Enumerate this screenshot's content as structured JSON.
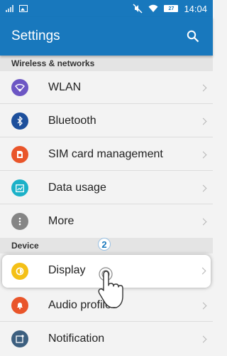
{
  "status_bar": {
    "time": "14:04",
    "battery": "27",
    "icons": [
      "signal-icon",
      "picture-icon",
      "mute-icon",
      "wifi-icon",
      "battery-icon"
    ]
  },
  "app_bar": {
    "title": "Settings",
    "search_icon": "search-icon"
  },
  "sections": {
    "wireless": "Wireless & networks",
    "device": "Device"
  },
  "items": [
    {
      "label": "WLAN",
      "icon": "wifi-icon",
      "color": "#6c56c4"
    },
    {
      "label": "Bluetooth",
      "icon": "bluetooth-icon",
      "color": "#1c4f9c"
    },
    {
      "label": "SIM card management",
      "icon": "sim-card-icon",
      "color": "#e9552a"
    },
    {
      "label": "Data usage",
      "icon": "data-usage-icon",
      "color": "#1bb1c8"
    },
    {
      "label": "More",
      "icon": "more-icon",
      "color": "#858585"
    },
    {
      "label": "Display",
      "icon": "display-brightness-icon",
      "color": "#f4c017"
    },
    {
      "label": "Audio profiles",
      "icon": "bell-icon",
      "color": "#e9552a"
    },
    {
      "label": "Notification",
      "icon": "notification-icon",
      "color": "#3c5f7f"
    }
  ],
  "tutorial": {
    "step": "2"
  },
  "colors": {
    "accent": "#1878bd",
    "background": "#f3f3f3",
    "section": "#e4e4e4"
  }
}
